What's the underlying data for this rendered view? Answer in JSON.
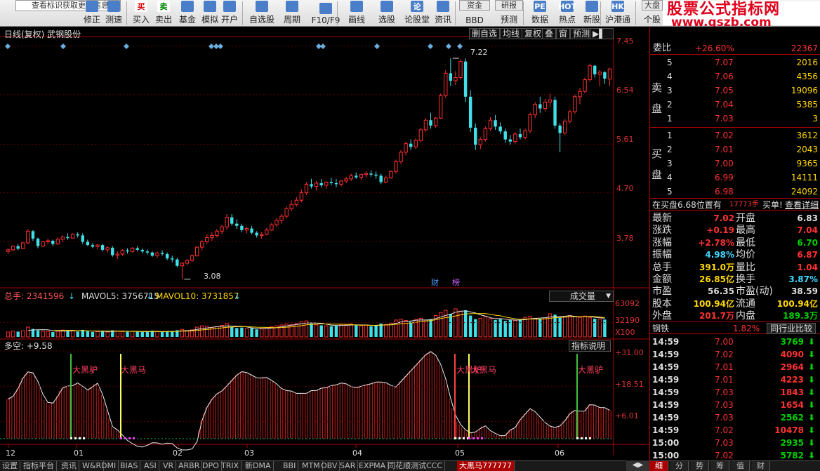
{
  "toolbar": {
    "tip": "查看标识获取更多信息",
    "items": [
      {
        "label": "修正",
        "icon": "edit-icon"
      },
      {
        "label": "测速",
        "icon": "speed-icon"
      },
      {
        "label": "买入",
        "icon": "buy-icon",
        "glyph": "买"
      },
      {
        "label": "卖出",
        "icon": "sell-icon",
        "glyph": "卖"
      },
      {
        "label": "基金",
        "icon": "fund-icon"
      },
      {
        "label": "模拟",
        "icon": "hammer-icon"
      },
      {
        "label": "开户",
        "icon": "lock-icon"
      },
      {
        "label": "自选股",
        "icon": "star-icon"
      },
      {
        "label": "周期",
        "icon": "clock-icon"
      },
      {
        "label": "F10/F9",
        "icon": "document-icon"
      },
      {
        "label": "画线",
        "icon": "draw-line-icon"
      },
      {
        "label": "选股",
        "icon": "screen-icon"
      },
      {
        "label": "论股堂",
        "icon": "discuss-icon",
        "glyph": "论"
      },
      {
        "label": "资讯",
        "icon": "news-icon"
      },
      {
        "label": "BBD",
        "icon": "fund-flow-icon",
        "top": "资金"
      },
      {
        "label": "预测",
        "icon": "forecast-icon",
        "top": "研报"
      },
      {
        "label": "数据",
        "icon": "data-icon",
        "glyph": "PE"
      },
      {
        "label": "热点",
        "icon": "hot-icon",
        "glyph": "HOT"
      },
      {
        "label": "新股",
        "icon": "ipo-icon"
      },
      {
        "label": "沪港通",
        "icon": "hk-connect-icon",
        "glyph": "HK"
      },
      {
        "label": "个股",
        "icon": "market-icon",
        "top": "大盘"
      }
    ]
  },
  "brand": {
    "line1": "股票公式指标网",
    "line2": "www.gszb.com"
  },
  "main": {
    "title": "日线(复权)  武钢股份",
    "buttons": [
      "删自选",
      "均线",
      "复权",
      "叠",
      "窗",
      "预测"
    ],
    "yticks": [
      "7.45",
      "6.54",
      "5.61",
      "4.70",
      "3.78"
    ],
    "high_label": "7.22",
    "low_label": "3.08",
    "badges": [
      "财",
      "榜"
    ]
  },
  "volume": {
    "total": "总手: 2341596",
    "ma5": "MAVOL5: 3756715",
    "ma10": "MAVOL10: 3731857",
    "dropdown": "成交量",
    "yticks": [
      "63092",
      "32190",
      "X100"
    ]
  },
  "indicator": {
    "title": "多空: +9.58",
    "button": "指标说明",
    "yticks": [
      "+31.00",
      "+18.51",
      "+6.01"
    ],
    "signals": [
      "大黑驴",
      "大黑马",
      "大黑驴",
      "大黑马",
      "大黑驴"
    ]
  },
  "xaxis": [
    "12",
    "01",
    "02",
    "03",
    "04",
    "05",
    "06"
  ],
  "bottom_tabs": [
    "设置",
    "指标平台",
    "资讯",
    "W&R",
    "DMI",
    "BIAS",
    "ASI",
    "VR",
    "ARBR",
    "DPO",
    "TRIX",
    "新DMA",
    "BBI",
    "MTM",
    "OBV",
    "SAR",
    "EXPMA",
    "同花顺测试CCC",
    "大黑马777777"
  ],
  "panel": {
    "weibi": {
      "label": "委比",
      "pct": "+26.60%",
      "val": "22367"
    },
    "sell_side": "卖盘",
    "buy_side": "买盘",
    "asks": [
      {
        "n": "5",
        "p": "7.07",
        "v": "2016"
      },
      {
        "n": "4",
        "p": "7.06",
        "v": "4356"
      },
      {
        "n": "3",
        "p": "7.05",
        "v": "19096"
      },
      {
        "n": "2",
        "p": "7.04",
        "v": "5385"
      },
      {
        "n": "1",
        "p": "7.03",
        "v": "3"
      }
    ],
    "bids": [
      {
        "n": "1",
        "p": "7.02",
        "v": "3612"
      },
      {
        "n": "2",
        "p": "7.01",
        "v": "2043"
      },
      {
        "n": "3",
        "p": "7.00",
        "v": "9365"
      },
      {
        "n": "4",
        "p": "6.99",
        "v": "14111"
      },
      {
        "n": "5",
        "p": "6.98",
        "v": "24092"
      }
    ],
    "notice": {
      "a": "在买盘6.68位置有",
      "b": "17773手",
      "c": "买单!",
      "d": "查看详细"
    },
    "stats": [
      {
        "l1": "最新",
        "v1": "7.02",
        "c1": "r",
        "l2": "开盘",
        "v2": "6.83",
        "c2": "w"
      },
      {
        "l1": "涨跌",
        "v1": "+0.19",
        "c1": "r",
        "l2": "最高",
        "v2": "7.04",
        "c2": "r"
      },
      {
        "l1": "涨幅",
        "v1": "+2.78%",
        "c1": "r",
        "l2": "最低",
        "v2": "6.70",
        "c2": "g"
      },
      {
        "l1": "振幅",
        "v1": "4.98%",
        "c1": "cy",
        "l2": "均价",
        "v2": "6.87",
        "c2": "r"
      },
      {
        "l1": "总手",
        "v1": "391.0万",
        "c1": "y",
        "l2": "量比",
        "v2": "1.04",
        "c2": "r"
      },
      {
        "l1": "金额",
        "v1": "26.85亿",
        "c1": "y",
        "l2": "换手",
        "v2": "3.87%",
        "c2": "cy"
      },
      {
        "l1": "市盈",
        "v1": "56.35",
        "c1": "w",
        "l2": "市盈(动)",
        "v2": "38.59",
        "c2": "w"
      },
      {
        "l1": "股本",
        "v1": "100.94亿",
        "c1": "y",
        "l2": "流通",
        "v2": "100.94亿",
        "c2": "y"
      },
      {
        "l1": "外盘",
        "v1": "201.7万",
        "c1": "r",
        "l2": "内盘",
        "v2": "189.3万",
        "c2": "g"
      }
    ],
    "industry": {
      "name": "钢铁",
      "pct": "1.82%",
      "btn": "同行业比较"
    },
    "ticks": [
      {
        "t": "14:59",
        "p": "7.00",
        "v": "3769",
        "d": "down"
      },
      {
        "t": "14:59",
        "p": "7.02",
        "v": "4090",
        "d": "down"
      },
      {
        "t": "14:59",
        "p": "7.01",
        "v": "2964",
        "d": "down"
      },
      {
        "t": "14:59",
        "p": "7.01",
        "v": "4223",
        "d": "down"
      },
      {
        "t": "14:59",
        "p": "7.03",
        "v": "1843",
        "d": "down"
      },
      {
        "t": "14:59",
        "p": "7.03",
        "v": "1654",
        "d": "down"
      },
      {
        "t": "14:59",
        "p": "7.03",
        "v": "2562",
        "d": "down"
      },
      {
        "t": "14:59",
        "p": "7.02",
        "v": "10478",
        "d": "down"
      },
      {
        "t": "15:00",
        "p": "7.03",
        "v": "2935",
        "d": "down"
      },
      {
        "t": "15:00",
        "p": "7.02",
        "v": "5782",
        "d": "down"
      }
    ],
    "tabs": [
      "细",
      "分",
      "势",
      "筹",
      "值",
      "财"
    ]
  },
  "chart_data": {
    "type": "candlestick",
    "title": "日线(复权)  武钢股份",
    "x_labels": [
      "12",
      "01",
      "02",
      "03",
      "04",
      "05",
      "06"
    ],
    "ylim": [
      3.05,
      7.55
    ],
    "ylim_volume": [
      0,
      63092
    ],
    "ylim_indicator": [
      -5,
      31
    ],
    "candles": [
      [
        3.6,
        3.66,
        3.55,
        3.63
      ],
      [
        3.63,
        3.72,
        3.6,
        3.7
      ],
      [
        3.7,
        3.74,
        3.62,
        3.65
      ],
      [
        3.65,
        3.78,
        3.64,
        3.76
      ],
      [
        3.76,
        4.02,
        3.74,
        3.98
      ],
      [
        3.98,
        4.0,
        3.8,
        3.84
      ],
      [
        3.84,
        3.86,
        3.66,
        3.7
      ],
      [
        3.7,
        3.8,
        3.68,
        3.78
      ],
      [
        3.78,
        3.84,
        3.74,
        3.8
      ],
      [
        3.8,
        3.82,
        3.7,
        3.74
      ],
      [
        3.74,
        3.86,
        3.72,
        3.83
      ],
      [
        3.83,
        3.9,
        3.78,
        3.87
      ],
      [
        3.87,
        3.94,
        3.82,
        3.85
      ],
      [
        3.85,
        3.94,
        3.84,
        3.92
      ],
      [
        3.92,
        3.96,
        3.86,
        3.9
      ],
      [
        3.9,
        3.94,
        3.74,
        3.78
      ],
      [
        3.78,
        3.82,
        3.7,
        3.72
      ],
      [
        3.72,
        3.76,
        3.66,
        3.69
      ],
      [
        3.69,
        3.74,
        3.64,
        3.72
      ],
      [
        3.72,
        3.74,
        3.6,
        3.63
      ],
      [
        3.63,
        3.7,
        3.58,
        3.67
      ],
      [
        3.67,
        3.7,
        3.5,
        3.53
      ],
      [
        3.53,
        3.6,
        3.46,
        3.55
      ],
      [
        3.55,
        3.64,
        3.52,
        3.62
      ],
      [
        3.62,
        3.66,
        3.56,
        3.6
      ],
      [
        3.6,
        3.68,
        3.58,
        3.66
      ],
      [
        3.66,
        3.7,
        3.6,
        3.63
      ],
      [
        3.63,
        3.66,
        3.56,
        3.6
      ],
      [
        3.6,
        3.64,
        3.54,
        3.58
      ],
      [
        3.58,
        3.6,
        3.5,
        3.52
      ],
      [
        3.52,
        3.6,
        3.48,
        3.57
      ],
      [
        3.57,
        3.62,
        3.52,
        3.55
      ],
      [
        3.55,
        3.58,
        3.44,
        3.47
      ],
      [
        3.47,
        3.52,
        3.4,
        3.45
      ],
      [
        3.45,
        3.48,
        3.3,
        3.33
      ],
      [
        3.33,
        3.4,
        3.08,
        3.38
      ],
      [
        3.38,
        3.46,
        3.34,
        3.43
      ],
      [
        3.43,
        3.55,
        3.4,
        3.52
      ],
      [
        3.52,
        3.7,
        3.5,
        3.68
      ],
      [
        3.68,
        3.82,
        3.62,
        3.78
      ],
      [
        3.78,
        3.92,
        3.74,
        3.86
      ],
      [
        3.86,
        3.96,
        3.8,
        3.9
      ],
      [
        3.9,
        4.02,
        3.86,
        3.98
      ],
      [
        3.98,
        4.1,
        3.92,
        4.06
      ],
      [
        4.06,
        4.3,
        4.0,
        4.24
      ],
      [
        4.24,
        4.3,
        4.08,
        4.12
      ],
      [
        4.12,
        4.2,
        4.02,
        4.08
      ],
      [
        4.08,
        4.12,
        3.96,
        4.0
      ],
      [
        4.0,
        4.06,
        3.94,
        4.03
      ],
      [
        4.03,
        4.08,
        3.92,
        3.95
      ],
      [
        3.95,
        3.98,
        3.86,
        3.9
      ],
      [
        3.9,
        3.96,
        3.84,
        3.92
      ],
      [
        3.92,
        4.04,
        3.9,
        4.0
      ],
      [
        4.0,
        4.14,
        3.98,
        4.1
      ],
      [
        4.1,
        4.22,
        4.06,
        4.18
      ],
      [
        4.18,
        4.3,
        4.12,
        4.26
      ],
      [
        4.26,
        4.44,
        4.22,
        4.4
      ],
      [
        4.4,
        4.56,
        4.36,
        4.48
      ],
      [
        4.48,
        4.62,
        4.44,
        4.56
      ],
      [
        4.56,
        4.76,
        4.52,
        4.7
      ],
      [
        4.7,
        4.9,
        4.66,
        4.86
      ],
      [
        4.86,
        4.96,
        4.78,
        4.82
      ],
      [
        4.82,
        4.92,
        4.74,
        4.88
      ],
      [
        4.88,
        4.96,
        4.8,
        4.84
      ],
      [
        4.84,
        4.92,
        4.78,
        4.9
      ],
      [
        4.9,
        4.98,
        4.84,
        4.88
      ],
      [
        4.88,
        4.96,
        4.8,
        4.86
      ],
      [
        4.86,
        4.94,
        4.82,
        4.92
      ],
      [
        4.92,
        5.0,
        4.88,
        4.96
      ],
      [
        4.96,
        5.06,
        4.92,
        5.02
      ],
      [
        5.02,
        5.08,
        4.96,
        4.99
      ],
      [
        4.99,
        5.06,
        4.94,
        5.04
      ],
      [
        5.04,
        5.1,
        4.98,
        5.06
      ],
      [
        5.06,
        5.12,
        5.0,
        5.04
      ],
      [
        5.04,
        5.1,
        4.96,
        5.02
      ],
      [
        5.02,
        5.06,
        4.86,
        4.9
      ],
      [
        4.9,
        5.02,
        4.88,
        4.98
      ],
      [
        4.98,
        5.12,
        4.96,
        5.1
      ],
      [
        5.1,
        5.32,
        5.06,
        5.28
      ],
      [
        5.28,
        5.5,
        5.24,
        5.46
      ],
      [
        5.46,
        5.66,
        5.4,
        5.62
      ],
      [
        5.62,
        5.7,
        5.5,
        5.56
      ],
      [
        5.56,
        5.72,
        5.52,
        5.68
      ],
      [
        5.68,
        5.92,
        5.64,
        5.88
      ],
      [
        5.88,
        6.1,
        5.84,
        6.06
      ],
      [
        6.06,
        6.2,
        5.9,
        5.96
      ],
      [
        5.96,
        6.12,
        5.92,
        6.1
      ],
      [
        6.1,
        6.56,
        6.08,
        6.52
      ],
      [
        6.52,
        7.0,
        6.48,
        6.94
      ],
      [
        6.94,
        7.22,
        6.7,
        6.8
      ],
      [
        6.8,
        6.98,
        6.72,
        6.86
      ],
      [
        6.86,
        7.2,
        6.82,
        7.16
      ],
      [
        7.16,
        7.22,
        6.4,
        6.5
      ],
      [
        6.5,
        6.62,
        5.84,
        5.92
      ],
      [
        5.92,
        6.0,
        5.5,
        5.6
      ],
      [
        5.6,
        5.74,
        5.52,
        5.7
      ],
      [
        5.7,
        5.94,
        5.66,
        5.9
      ],
      [
        5.9,
        6.12,
        5.86,
        6.06
      ],
      [
        6.06,
        6.16,
        5.88,
        5.94
      ],
      [
        5.94,
        6.02,
        5.8,
        5.85
      ],
      [
        5.85,
        5.9,
        5.64,
        5.7
      ],
      [
        5.7,
        5.78,
        5.6,
        5.66
      ],
      [
        5.66,
        5.84,
        5.62,
        5.8
      ],
      [
        5.8,
        5.9,
        5.7,
        5.74
      ],
      [
        5.74,
        5.9,
        5.7,
        5.86
      ],
      [
        5.86,
        6.2,
        5.82,
        6.16
      ],
      [
        6.16,
        6.4,
        6.1,
        6.36
      ],
      [
        6.36,
        6.5,
        6.2,
        6.28
      ],
      [
        6.28,
        6.46,
        6.22,
        6.4
      ],
      [
        6.4,
        6.56,
        6.3,
        6.44
      ],
      [
        6.44,
        6.5,
        5.9,
        5.96
      ],
      [
        5.96,
        6.0,
        5.46,
        5.82
      ],
      [
        5.82,
        6.08,
        5.78,
        6.04
      ],
      [
        6.04,
        6.26,
        6.0,
        6.22
      ],
      [
        6.22,
        6.54,
        6.18,
        6.5
      ],
      [
        6.5,
        6.66,
        6.36,
        6.6
      ],
      [
        6.6,
        6.86,
        6.56,
        6.82
      ],
      [
        6.82,
        7.12,
        6.78,
        7.08
      ],
      [
        7.08,
        7.1,
        6.86,
        6.92
      ],
      [
        6.92,
        7.0,
        6.7,
        6.96
      ],
      [
        6.96,
        6.98,
        6.74,
        6.84
      ],
      [
        6.83,
        7.04,
        6.7,
        7.02
      ]
    ],
    "volume": [
      11000,
      13000,
      12000,
      14000,
      22000,
      18000,
      15000,
      13000,
      12500,
      11000,
      14000,
      15500,
      13000,
      14500,
      12000,
      16000,
      12500,
      11000,
      12000,
      13500,
      11000,
      15000,
      13000,
      12000,
      11500,
      12500,
      13000,
      11000,
      11500,
      14000,
      12000,
      11000,
      13000,
      12000,
      15000,
      17000,
      14000,
      16000,
      22000,
      25000,
      24000,
      21000,
      23000,
      26000,
      30000,
      22000,
      20000,
      21000,
      19000,
      20000,
      17000,
      18000,
      21000,
      23000,
      25000,
      27000,
      29000,
      28000,
      30000,
      34000,
      36000,
      30000,
      27000,
      26000,
      25000,
      24000,
      26000,
      28000,
      27000,
      29000,
      26000,
      25000,
      27000,
      24000,
      26000,
      30000,
      28000,
      31000,
      38000,
      40000,
      37000,
      34000,
      39000,
      42000,
      38000,
      40000,
      48000,
      55000,
      60000,
      52000,
      63092,
      58000,
      60000,
      48000,
      40000,
      42000,
      45000,
      41000,
      38000,
      40000,
      36000,
      38000,
      37000,
      39000,
      44000,
      46000,
      42000,
      41000,
      43000,
      52000,
      50000,
      43000,
      45000,
      48000,
      46000,
      44000,
      47000,
      43000,
      41000,
      40000,
      39000
    ],
    "indicator": [
      14,
      15,
      18,
      22,
      24,
      23,
      19,
      14,
      12,
      13,
      17,
      19,
      18,
      20,
      19,
      17,
      18,
      20,
      16,
      10,
      4,
      3,
      1,
      -1,
      -2,
      -3,
      -3,
      -2,
      -1,
      -2,
      -2,
      -1,
      -3,
      -4,
      -4,
      -4,
      -2,
      6,
      11,
      14,
      16,
      17,
      19,
      21,
      23,
      24,
      23,
      22,
      21,
      22,
      21,
      20,
      18,
      17,
      17,
      16,
      16,
      16,
      17,
      17,
      18,
      18,
      19,
      19,
      20,
      19,
      18,
      18,
      19,
      19,
      20,
      20,
      20,
      19,
      18,
      20,
      22,
      24,
      26,
      28,
      30,
      31,
      29,
      25,
      19,
      11,
      6,
      4,
      2,
      2,
      3,
      5,
      3,
      2,
      1,
      1,
      3,
      4,
      7,
      9,
      11,
      9,
      7,
      5,
      4,
      4,
      5,
      8,
      10,
      10,
      9,
      12,
      12,
      11,
      11,
      10
    ],
    "signals": [
      {
        "i": 22,
        "label": "大黑驴"
      },
      {
        "i": 40,
        "label": "大黑马"
      },
      {
        "i": 159,
        "label": "大黑驴"
      },
      {
        "i": 164,
        "label": "大黑马"
      },
      {
        "i": 199,
        "label": "大黑驴"
      }
    ]
  }
}
